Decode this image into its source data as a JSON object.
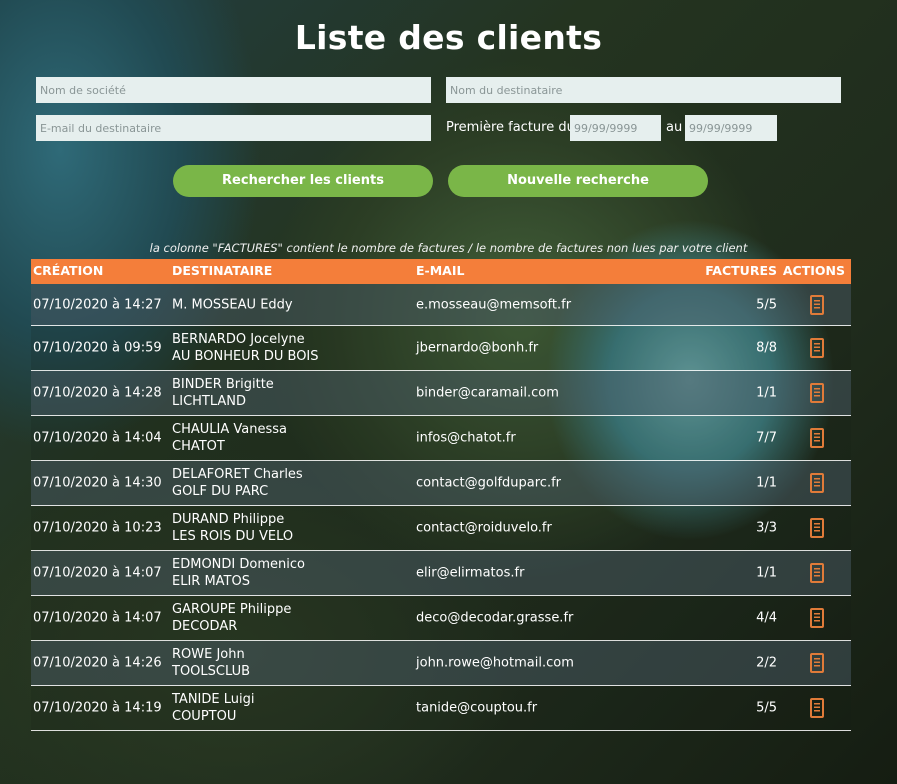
{
  "page": {
    "title": "Liste des clients"
  },
  "filters": {
    "company_placeholder": "Nom de société",
    "recipient_placeholder": "Nom du destinataire",
    "email_placeholder": "E-mail du destinataire",
    "first_invoice_label": "Première facture du",
    "date_from_placeholder": "99/99/9999",
    "au_label": "au",
    "date_to_placeholder": "99/99/9999"
  },
  "buttons": {
    "search_label": "Rechercher les clients",
    "reset_label": "Nouvelle recherche"
  },
  "note": "la colonne \"FACTURES\" contient le nombre de factures / le nombre de factures non lues par votre client",
  "table": {
    "headers": {
      "creation": "CRÉATION",
      "destinataire": "DESTINATAIRE",
      "email": "E-MAIL",
      "factures": "FACTURES",
      "actions": "ACTIONS"
    },
    "rows": [
      {
        "creation": "07/10/2020 à 14:27",
        "name": "M. MOSSEAU Eddy",
        "company": "",
        "email": "e.mosseau@memsoft.fr",
        "factures": "5/5"
      },
      {
        "creation": "07/10/2020 à 09:59",
        "name": "BERNARDO Jocelyne",
        "company": "AU BONHEUR DU BOIS",
        "email": "jbernardo@bonh.fr",
        "factures": "8/8"
      },
      {
        "creation": "07/10/2020 à 14:28",
        "name": "BINDER Brigitte",
        "company": "LICHTLAND",
        "email": "binder@caramail.com",
        "factures": "1/1"
      },
      {
        "creation": "07/10/2020 à 14:04",
        "name": "CHAULIA Vanessa",
        "company": "CHATOT",
        "email": "infos@chatot.fr",
        "factures": "7/7"
      },
      {
        "creation": "07/10/2020 à 14:30",
        "name": "DELAFORET Charles",
        "company": "GOLF DU PARC",
        "email": "contact@golfduparc.fr",
        "factures": "1/1"
      },
      {
        "creation": "07/10/2020 à 10:23",
        "name": "DURAND Philippe",
        "company": "LES ROIS DU VELO",
        "email": "contact@roiduvelo.fr",
        "factures": "3/3"
      },
      {
        "creation": "07/10/2020 à 14:07",
        "name": "EDMONDI Domenico",
        "company": "ELIR MATOS",
        "email": "elir@elirmatos.fr",
        "factures": "1/1"
      },
      {
        "creation": "07/10/2020 à 14:07",
        "name": "GAROUPE Philippe",
        "company": "DECODAR",
        "email": "deco@decodar.grasse.fr",
        "factures": "4/4"
      },
      {
        "creation": "07/10/2020 à 14:26",
        "name": "ROWE John",
        "company": "TOOLSCLUB",
        "email": "john.rowe@hotmail.com",
        "factures": "2/2"
      },
      {
        "creation": "07/10/2020 à 14:19",
        "name": "TANIDE Luigi",
        "company": "COUPTOU",
        "email": "tanide@couptou.fr",
        "factures": "5/5"
      }
    ]
  },
  "icons": {
    "action": "invoice-list-icon"
  },
  "colors": {
    "header": "#f47e3a",
    "button": "#7ab648",
    "icon": "#e07b39"
  }
}
